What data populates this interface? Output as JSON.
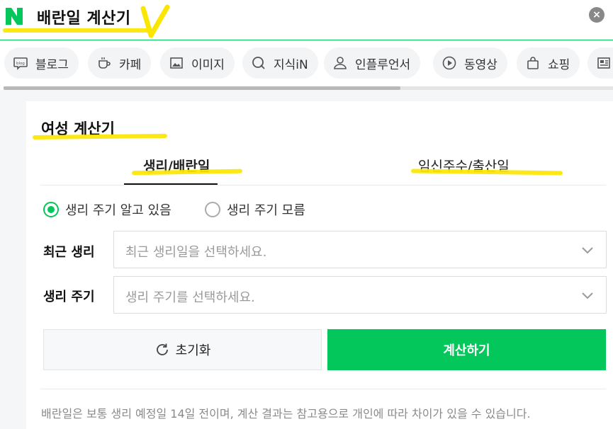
{
  "header": {
    "query": "배란일 계산기",
    "logo_letter": "N",
    "close_label": "×"
  },
  "chips": [
    {
      "icon": "blog-icon",
      "label": "블로그"
    },
    {
      "icon": "cafe-icon",
      "label": "카페"
    },
    {
      "icon": "image-icon",
      "label": "이미지"
    },
    {
      "icon": "kin-icon",
      "label": "지식iN"
    },
    {
      "icon": "person-icon",
      "label": "인플루언서"
    },
    {
      "icon": "play-icon",
      "label": "동영상"
    },
    {
      "icon": "bag-icon",
      "label": "쇼핑"
    },
    {
      "icon": "news-icon",
      "label": ""
    }
  ],
  "calculator": {
    "title": "여성 계산기",
    "tabs": [
      {
        "label": "생리/배란일",
        "active": true
      },
      {
        "label": "임신주수/출산일",
        "active": false
      }
    ],
    "radios": [
      {
        "label": "생리 주기 알고 있음",
        "checked": true
      },
      {
        "label": "생리 주기 모름",
        "checked": false
      }
    ],
    "fields": [
      {
        "label": "최근 생리",
        "placeholder": "최근 생리일을 선택하세요."
      },
      {
        "label": "생리 주기",
        "placeholder": "생리 주기를 선택하세요."
      }
    ],
    "reset_label": "초기화",
    "calc_label": "계산하기",
    "note": "배란일은 보통 생리 예정일 14일 전이며, 계산 결과는 참고용으로 개인에 따라 차이가 있을 수 있습니다."
  },
  "colors": {
    "brand_green": "#03c75a",
    "highlighter": "#fbe600"
  }
}
